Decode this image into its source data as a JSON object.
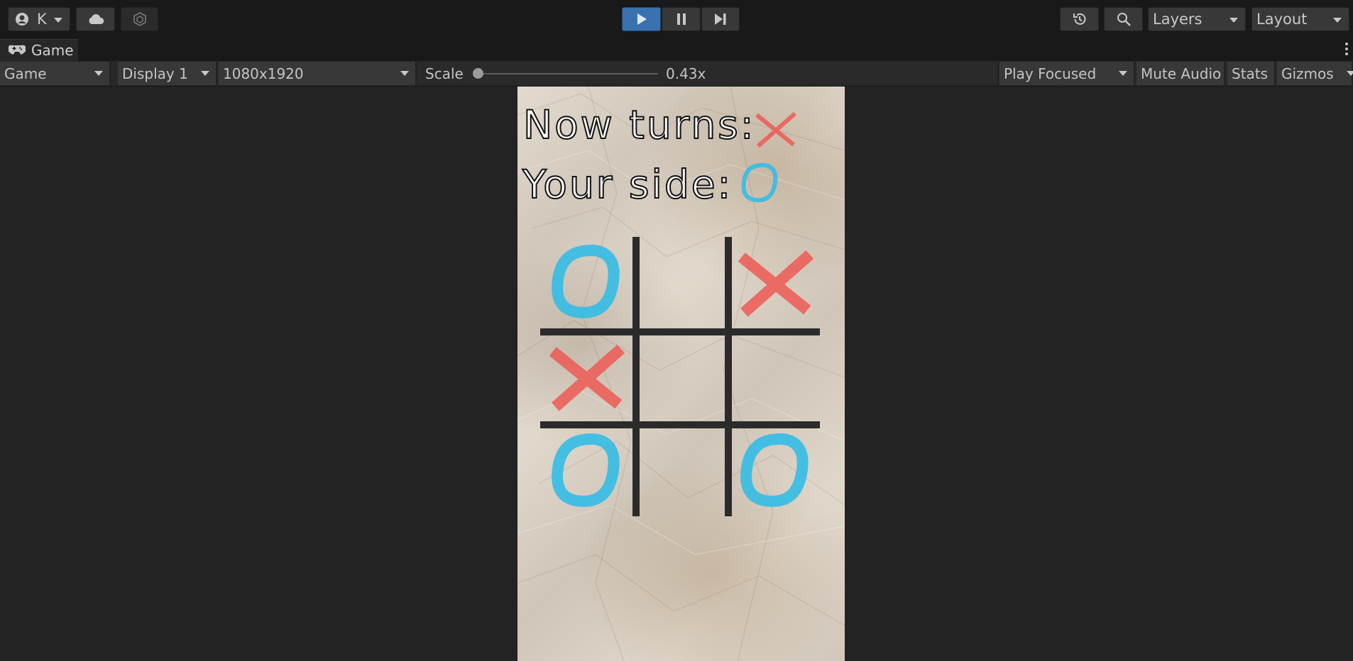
{
  "toolbar": {
    "account_label": "K",
    "layers_label": "Layers",
    "layout_label": "Layout"
  },
  "window": {
    "tab_label": "Game"
  },
  "controls": {
    "mode": "Game",
    "display": "Display 1",
    "resolution": "1080x1920",
    "scale_label": "Scale",
    "scale_value": "0.43x",
    "play_focus": "Play Focused",
    "mute_audio": "Mute Audio",
    "stats": "Stats",
    "gizmos": "Gizmos"
  },
  "game": {
    "now_turns_label": "Now turns:",
    "your_side_label": "Your side:",
    "current_turn": "X",
    "player_side": "O",
    "board": [
      "O",
      "",
      "X",
      "X",
      "",
      "",
      "O",
      "",
      "O"
    ]
  },
  "colors": {
    "x_mark": "#ee5b55",
    "o_mark": "#33bde6",
    "play_active": "#3a72b0",
    "grid_line": "#2b2b2b"
  }
}
